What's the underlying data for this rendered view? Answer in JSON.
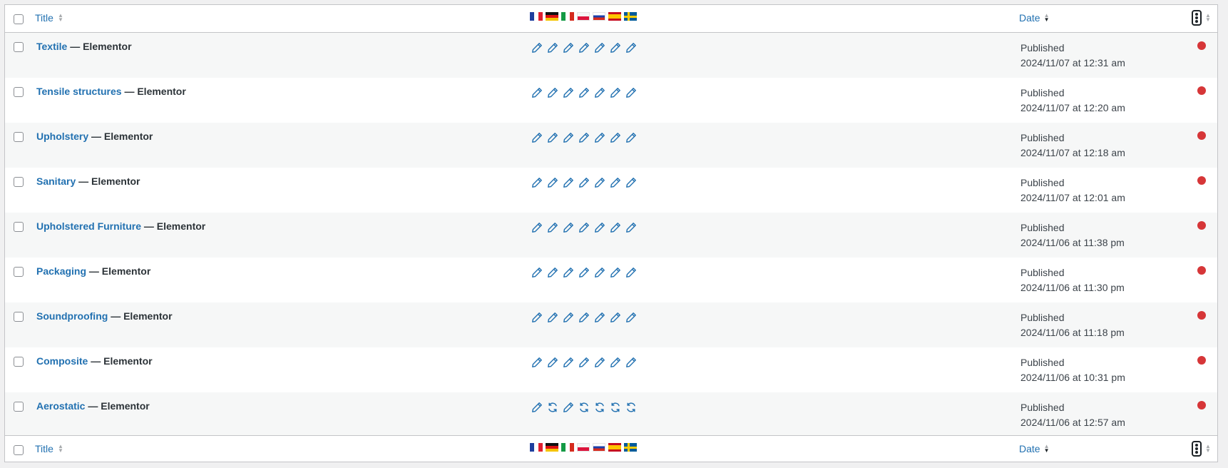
{
  "header": {
    "title_label": "Title",
    "date_label": "Date"
  },
  "footer": {
    "title_label": "Title",
    "date_label": "Date"
  },
  "languages": [
    "fr",
    "de",
    "it",
    "pl",
    "ru",
    "es",
    "se"
  ],
  "colors": {
    "link": "#2271b1",
    "status_dot": "#d63638",
    "row_alt_bg": "#f6f7f7",
    "border": "#c3c4c7"
  },
  "rows": [
    {
      "title": "Textile",
      "suffix": " — Elementor",
      "status": "Published",
      "date": "2024/11/07 at 12:31 am",
      "translations": [
        "edit-icon",
        "edit-icon",
        "edit-icon",
        "edit-icon",
        "edit-icon",
        "edit-icon",
        "edit-icon"
      ]
    },
    {
      "title": "Tensile structures",
      "suffix": " — Elementor",
      "status": "Published",
      "date": "2024/11/07 at 12:20 am",
      "translations": [
        "edit-icon",
        "edit-icon",
        "edit-icon",
        "edit-icon",
        "edit-icon",
        "edit-icon",
        "edit-icon"
      ]
    },
    {
      "title": "Upholstery",
      "suffix": " — Elementor",
      "status": "Published",
      "date": "2024/11/07 at 12:18 am",
      "translations": [
        "edit-icon",
        "edit-icon",
        "edit-icon",
        "edit-icon",
        "edit-icon",
        "edit-icon",
        "edit-icon"
      ]
    },
    {
      "title": "Sanitary",
      "suffix": " — Elementor",
      "status": "Published",
      "date": "2024/11/07 at 12:01 am",
      "translations": [
        "edit-icon",
        "edit-icon",
        "edit-icon",
        "edit-icon",
        "edit-icon",
        "edit-icon",
        "edit-icon"
      ]
    },
    {
      "title": "Upholstered Furniture",
      "suffix": " — Elementor",
      "status": "Published",
      "date": "2024/11/06 at 11:38 pm",
      "translations": [
        "edit-icon",
        "edit-icon",
        "edit-icon",
        "edit-icon",
        "edit-icon",
        "edit-icon",
        "edit-icon"
      ]
    },
    {
      "title": "Packaging",
      "suffix": " — Elementor",
      "status": "Published",
      "date": "2024/11/06 at 11:30 pm",
      "translations": [
        "edit-icon",
        "edit-icon",
        "edit-icon",
        "edit-icon",
        "edit-icon",
        "edit-icon",
        "edit-icon"
      ]
    },
    {
      "title": "Soundproofing",
      "suffix": " — Elementor",
      "status": "Published",
      "date": "2024/11/06 at 11:18 pm",
      "translations": [
        "edit-icon",
        "edit-icon",
        "edit-icon",
        "edit-icon",
        "edit-icon",
        "edit-icon",
        "edit-icon"
      ]
    },
    {
      "title": "Composite",
      "suffix": " — Elementor",
      "status": "Published",
      "date": "2024/11/06 at 10:31 pm",
      "translations": [
        "edit-icon",
        "edit-icon",
        "edit-icon",
        "edit-icon",
        "edit-icon",
        "edit-icon",
        "edit-icon"
      ]
    },
    {
      "title": "Aerostatic",
      "suffix": " — Elementor",
      "status": "Published",
      "date": "2024/11/06 at 12:57 am",
      "translations": [
        "edit-icon",
        "sync-icon",
        "edit-icon",
        "sync-icon",
        "sync-icon",
        "sync-icon",
        "sync-icon"
      ]
    }
  ]
}
